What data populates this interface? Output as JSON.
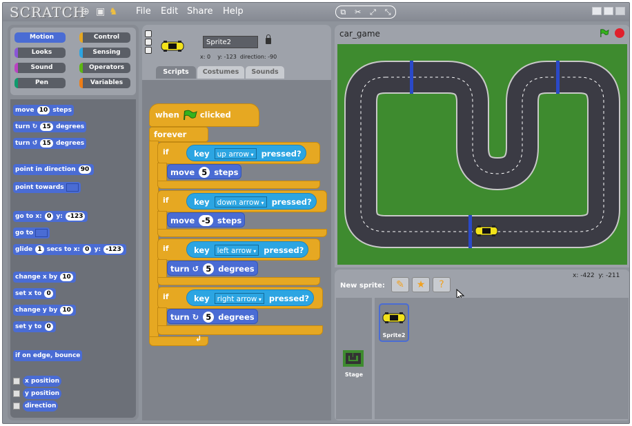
{
  "menubar": {
    "logo": "SCRATCH",
    "menus": [
      "File",
      "Edit",
      "Share",
      "Help"
    ]
  },
  "categories": [
    {
      "label": "Motion",
      "color": "#4a6cd4"
    },
    {
      "label": "Control",
      "color": "#e6a822"
    },
    {
      "label": "Looks",
      "color": "#8a55d7"
    },
    {
      "label": "Sensing",
      "color": "#2ca5e2"
    },
    {
      "label": "Sound",
      "color": "#bb42c3"
    },
    {
      "label": "Operators",
      "color": "#5cb712"
    },
    {
      "label": "Pen",
      "color": "#0e9a6c"
    },
    {
      "label": "Variables",
      "color": "#ee7d16"
    }
  ],
  "palette": {
    "move": [
      "move",
      "10",
      "steps"
    ],
    "turn_right": [
      "turn",
      "15",
      "degrees"
    ],
    "turn_left": [
      "turn",
      "15",
      "degrees"
    ],
    "point_in_direction": [
      "point in direction",
      "90"
    ],
    "point_towards": "point towards",
    "go_to_xy": [
      "go to x:",
      "0",
      "y:",
      "-123"
    ],
    "go_to": "go to",
    "glide": [
      "glide",
      "1",
      "secs to x:",
      "0",
      "y:",
      "-123"
    ],
    "change_x": [
      "change x by",
      "10"
    ],
    "set_x": [
      "set x to",
      "0"
    ],
    "change_y": [
      "change y by",
      "10"
    ],
    "set_y": [
      "set y to",
      "0"
    ],
    "bounce": "if on edge, bounce",
    "x_position": "x position",
    "y_position": "y position",
    "direction": "direction"
  },
  "sprite_info": {
    "name": "Sprite2",
    "x": "x: 0",
    "y": "y: -123",
    "direction": "direction: -90"
  },
  "tabs": [
    "Scripts",
    "Costumes",
    "Sounds"
  ],
  "script": {
    "hat_left": "when",
    "hat_right": "clicked",
    "forever": "forever",
    "if_label": "if",
    "key": "key",
    "pressed": "pressed?",
    "keys": [
      "up arrow",
      "down arrow",
      "left arrow",
      "right arrow"
    ],
    "move1": [
      "move",
      "5",
      "steps"
    ],
    "move2": [
      "move",
      "-5",
      "steps"
    ],
    "turn1": [
      "turn",
      "5",
      "degrees"
    ],
    "turn2": [
      "turn",
      "5",
      "degrees"
    ]
  },
  "stage": {
    "title": "car_game"
  },
  "sprites_panel": {
    "new_sprite_label": "New sprite:",
    "mouse_x": "x: -422",
    "mouse_y": "y: -211",
    "sprite_label": "Sprite2",
    "stage_label": "Stage"
  }
}
